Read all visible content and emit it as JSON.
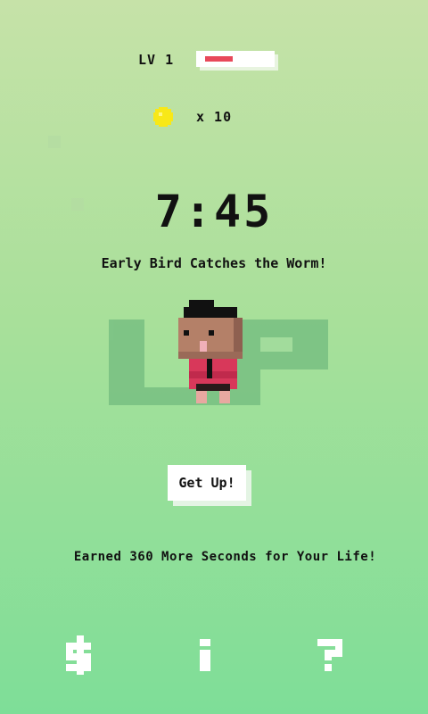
{
  "level": {
    "label": "LV 1",
    "progress": 0.45
  },
  "coins": {
    "icon": "coin-icon",
    "count_text": "x 10",
    "color": "#f8e818"
  },
  "clock": {
    "time": "7:45"
  },
  "message": {
    "text": "Early Bird Catches the Worm!"
  },
  "backdrop": {
    "text": "UP"
  },
  "button": {
    "label": "Get Up!"
  },
  "earned": {
    "text": "Earned 360 More Seconds for Your Life!"
  },
  "bottom_icons": [
    {
      "name": "dollar-icon",
      "glyph": "$"
    },
    {
      "name": "info-icon",
      "glyph": "i"
    },
    {
      "name": "help-icon",
      "glyph": "?"
    }
  ],
  "colors": {
    "background_top": "#c6e2a8",
    "background_bottom": "#7ede98",
    "level_fill": "#e8485a",
    "shirt": "#d8385a",
    "skin": "#b48068"
  }
}
